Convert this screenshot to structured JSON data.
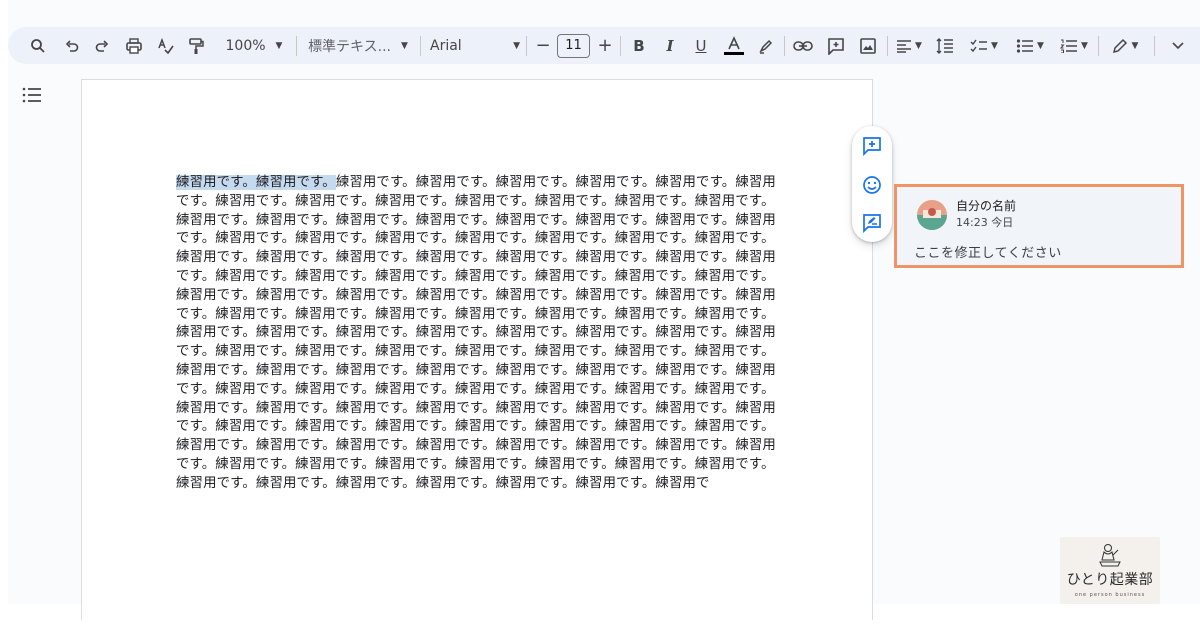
{
  "toolbar": {
    "zoom": "100%",
    "style": "標準テキス...",
    "font": "Arial",
    "font_size": "11",
    "minus": "−",
    "plus": "+"
  },
  "document": {
    "highlighted": "練習用です。練習用です。",
    "body": "練習用です。練習用です。練習用です。練習用です。練習用です。練習用です。練習用です。練習用です。練習用です。練習用です。練習用です。練習用です。練習用です。練習用です。練習用です。練習用です。練習用です。練習用です。練習用です。練習用です。練習用です。練習用です。練習用です。練習用です。練習用です。練習用です。練習用です。練習用です。練習用です。練習用です。練習用です。練習用です。練習用です。練習用です。練習用です。練習用です。練習用です。練習用です。練習用です。練習用です。練習用です。練習用です。練習用です。練習用です。練習用です。練習用です。練習用です。練習用です。練習用です。練習用です。練習用です。練習用です。練習用です。練習用です。練習用です。練習用です。練習用です。練習用です。練習用です。練習用です。練習用です。練習用です。練習用です。練習用です。練習用です。練習用です。練習用です。練習用です。練習用です。練習用です。練習用です。練習用です。練習用です。練習用です。練習用です。練習用です。練習用です。練習用です。練習用です。練習用です。練習用です。練習用です。練習用です。練習用です。練習用です。練習用です。練習用です。練習用です。練習用です。練習用です。練習用です。練習用です。練習用です。練習用です。練習用です。練習用です。練習用です。練習用です。練習用です。練習用です。練習用です。練習用です。練習用です。練習用です。練習用です。練習用です。練習用です。練習用です。練習用です。練習用です。練習用です。練習用です。練習用です。練習用です。練習用です。練習用です。練習用です。練習用です。練習用です。練習用です。練習用です。練習用です。練習用です。練習用です。練習用で"
  },
  "comment": {
    "author": "自分の名前",
    "time": "14:23 今日",
    "text": "ここを修正してください"
  },
  "watermark": {
    "title": "ひとり起業部",
    "subtitle": "one person business"
  },
  "colors": {
    "toolbar_bg": "#edf2fa",
    "comment_border": "#ef9464",
    "highlight": "#c5d9ef",
    "accent_blue": "#1a73e8"
  }
}
